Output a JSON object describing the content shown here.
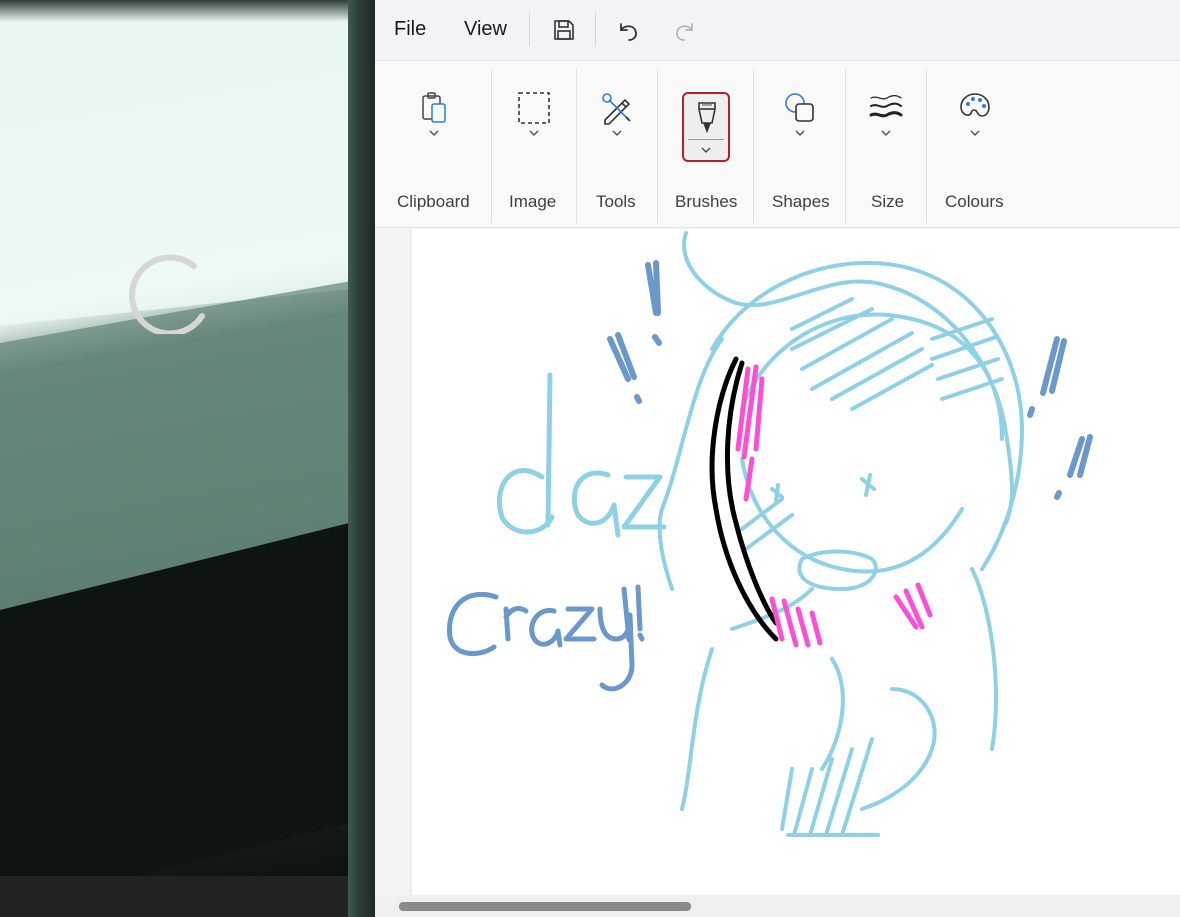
{
  "menubar": {
    "file_label": "File",
    "view_label": "View",
    "icons": [
      "save-icon",
      "undo-icon",
      "redo-icon"
    ]
  },
  "ribbon": {
    "groups": [
      {
        "label": "Clipboard",
        "icon": "clipboard-icon"
      },
      {
        "label": "Image",
        "icon": "selection-icon"
      },
      {
        "label": "Tools",
        "icon": "tools-icon"
      },
      {
        "label": "Brushes",
        "icon": "brush-icon",
        "selected": true
      },
      {
        "label": "Shapes",
        "icon": "shapes-icon"
      },
      {
        "label": "Size",
        "icon": "stroke-size-icon"
      },
      {
        "label": "Colours",
        "icon": "palette-icon"
      }
    ]
  },
  "canvas": {
    "drawing_text": [
      "daz",
      "crazy!!"
    ],
    "stroke_colors": {
      "blue": "#8fd0e4",
      "dark_blue": "#6c97c9",
      "pink": "#ff4fd3",
      "black": "#000000"
    }
  },
  "colors": {
    "accent": "#b0222d",
    "menubar": "#f3f2f7",
    "ribbon": "#f9f9f9"
  }
}
